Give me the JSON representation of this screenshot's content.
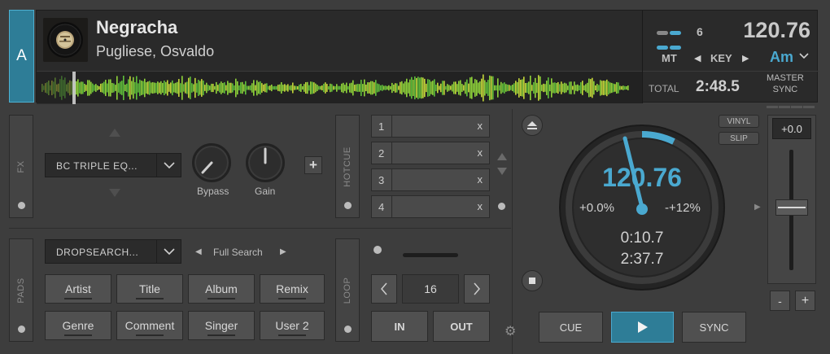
{
  "deck": {
    "letter": "A"
  },
  "track": {
    "title": "Negracha",
    "artist": "Pugliese, Osvaldo",
    "deck_number": "6",
    "bpm": "120.76",
    "mt_label": "MT",
    "key_label": "KEY",
    "key_value": "Am",
    "total_label": "TOTAL",
    "total_time": "2:48.5",
    "master_label": "MASTER",
    "sync_label": "SYNC"
  },
  "fx": {
    "tab_label": "FX",
    "effect_name": "BC TRIPLE EQ...",
    "knob1_label": "Bypass",
    "knob2_label": "Gain",
    "add_label": "+"
  },
  "hotcue": {
    "tab_label": "HOTCUE",
    "cues": [
      {
        "num": "1",
        "clear": "x"
      },
      {
        "num": "2",
        "clear": "x"
      },
      {
        "num": "3",
        "clear": "x"
      },
      {
        "num": "4",
        "clear": "x"
      }
    ]
  },
  "pads": {
    "tab_label": "PADS",
    "mode": "DROPSEARCH...",
    "search_label": "Full Search",
    "buttons": [
      "Artist",
      "Title",
      "Album",
      "Remix",
      "Genre",
      "Comment",
      "Singer",
      "User 2"
    ]
  },
  "loop": {
    "tab_label": "LOOP",
    "length": "16",
    "in_label": "IN",
    "out_label": "OUT"
  },
  "jog": {
    "bpm": "120.76",
    "pitch_pct": "+0.0%",
    "range": "-+12%",
    "elapsed": "0:10.7",
    "remaining": "2:37.7"
  },
  "transport": {
    "cue_label": "CUE",
    "sync_label": "SYNC",
    "vinyl_label": "VINYL",
    "slip_label": "SLIP"
  },
  "pitch": {
    "value": "+0.0",
    "minus_label": "-",
    "plus_label": "+"
  },
  "colors": {
    "accent": "#4aa9d0",
    "deck_tab": "#2e7d97",
    "waveform": "#8fd43a"
  }
}
